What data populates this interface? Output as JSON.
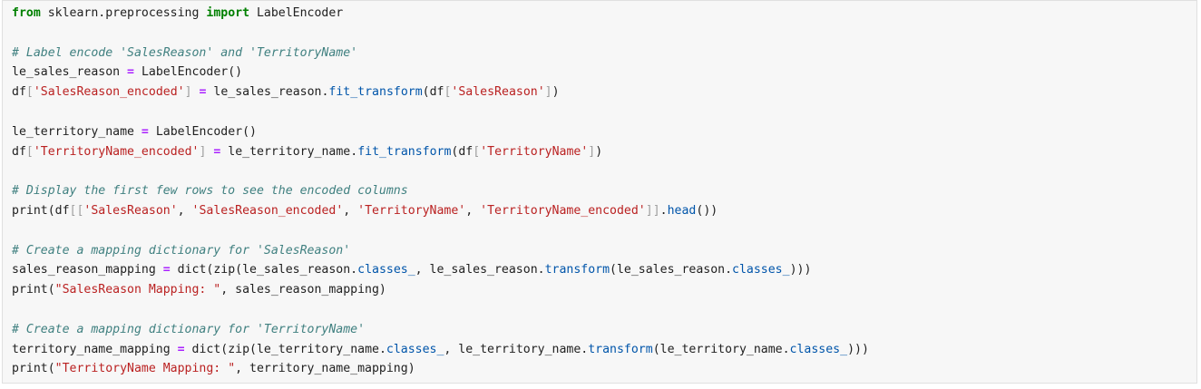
{
  "code_cell": {
    "lines": [
      [
        {
          "t": "from",
          "c": "kw"
        },
        {
          "t": " sklearn.preprocessing ",
          "c": "tx"
        },
        {
          "t": "import",
          "c": "kw"
        },
        {
          "t": " LabelEncoder",
          "c": "tx"
        }
      ],
      [],
      [
        {
          "t": "# Label encode 'SalesReason' and 'TerritoryName'",
          "c": "cm"
        }
      ],
      [
        {
          "t": "le_sales_reason ",
          "c": "tx"
        },
        {
          "t": "=",
          "c": "op"
        },
        {
          "t": " LabelEncoder()",
          "c": "tx"
        }
      ],
      [
        {
          "t": "df",
          "c": "tx"
        },
        {
          "t": "[",
          "c": "br"
        },
        {
          "t": "'SalesReason_encoded'",
          "c": "str"
        },
        {
          "t": "]",
          "c": "br"
        },
        {
          "t": " ",
          "c": "tx"
        },
        {
          "t": "=",
          "c": "op"
        },
        {
          "t": " le_sales_reason.",
          "c": "tx"
        },
        {
          "t": "fit_transform",
          "c": "fn"
        },
        {
          "t": "(df",
          "c": "tx"
        },
        {
          "t": "[",
          "c": "br"
        },
        {
          "t": "'SalesReason'",
          "c": "str"
        },
        {
          "t": "]",
          "c": "br"
        },
        {
          "t": ")",
          "c": "tx"
        }
      ],
      [],
      [
        {
          "t": "le_territory_name ",
          "c": "tx"
        },
        {
          "t": "=",
          "c": "op"
        },
        {
          "t": " LabelEncoder()",
          "c": "tx"
        }
      ],
      [
        {
          "t": "df",
          "c": "tx"
        },
        {
          "t": "[",
          "c": "br"
        },
        {
          "t": "'TerritoryName_encoded'",
          "c": "str"
        },
        {
          "t": "]",
          "c": "br"
        },
        {
          "t": " ",
          "c": "tx"
        },
        {
          "t": "=",
          "c": "op"
        },
        {
          "t": " le_territory_name.",
          "c": "tx"
        },
        {
          "t": "fit_transform",
          "c": "fn"
        },
        {
          "t": "(df",
          "c": "tx"
        },
        {
          "t": "[",
          "c": "br"
        },
        {
          "t": "'TerritoryName'",
          "c": "str"
        },
        {
          "t": "]",
          "c": "br"
        },
        {
          "t": ")",
          "c": "tx"
        }
      ],
      [],
      [
        {
          "t": "# Display the first few rows to see the encoded columns",
          "c": "cm"
        }
      ],
      [
        {
          "t": "print(df",
          "c": "tx"
        },
        {
          "t": "[[",
          "c": "br"
        },
        {
          "t": "'SalesReason'",
          "c": "str"
        },
        {
          "t": ", ",
          "c": "tx"
        },
        {
          "t": "'SalesReason_encoded'",
          "c": "str"
        },
        {
          "t": ", ",
          "c": "tx"
        },
        {
          "t": "'TerritoryName'",
          "c": "str"
        },
        {
          "t": ", ",
          "c": "tx"
        },
        {
          "t": "'TerritoryName_encoded'",
          "c": "str"
        },
        {
          "t": "]]",
          "c": "br"
        },
        {
          "t": ".",
          "c": "tx"
        },
        {
          "t": "head",
          "c": "fn"
        },
        {
          "t": "())",
          "c": "tx"
        }
      ],
      [],
      [
        {
          "t": "# Create a mapping dictionary for 'SalesReason'",
          "c": "cm"
        }
      ],
      [
        {
          "t": "sales_reason_mapping ",
          "c": "tx"
        },
        {
          "t": "=",
          "c": "op"
        },
        {
          "t": " dict(zip(le_sales_reason.",
          "c": "tx"
        },
        {
          "t": "classes_",
          "c": "fn"
        },
        {
          "t": ", le_sales_reason.",
          "c": "tx"
        },
        {
          "t": "transform",
          "c": "fn"
        },
        {
          "t": "(le_sales_reason.",
          "c": "tx"
        },
        {
          "t": "classes_",
          "c": "fn"
        },
        {
          "t": ")))",
          "c": "tx"
        }
      ],
      [
        {
          "t": "print(",
          "c": "tx"
        },
        {
          "t": "\"SalesReason Mapping: \"",
          "c": "str"
        },
        {
          "t": ", sales_reason_mapping)",
          "c": "tx"
        }
      ],
      [],
      [
        {
          "t": "# Create a mapping dictionary for 'TerritoryName'",
          "c": "cm"
        }
      ],
      [
        {
          "t": "territory_name_mapping ",
          "c": "tx"
        },
        {
          "t": "=",
          "c": "op"
        },
        {
          "t": " dict(zip(le_territory_name.",
          "c": "tx"
        },
        {
          "t": "classes_",
          "c": "fn"
        },
        {
          "t": ", le_territory_name.",
          "c": "tx"
        },
        {
          "t": "transform",
          "c": "fn"
        },
        {
          "t": "(le_territory_name.",
          "c": "tx"
        },
        {
          "t": "classes_",
          "c": "fn"
        },
        {
          "t": ")))",
          "c": "tx"
        }
      ],
      [
        {
          "t": "print(",
          "c": "tx"
        },
        {
          "t": "\"TerritoryName Mapping: \"",
          "c": "str"
        },
        {
          "t": ", territory_name_mapping)",
          "c": "tx"
        }
      ]
    ]
  }
}
